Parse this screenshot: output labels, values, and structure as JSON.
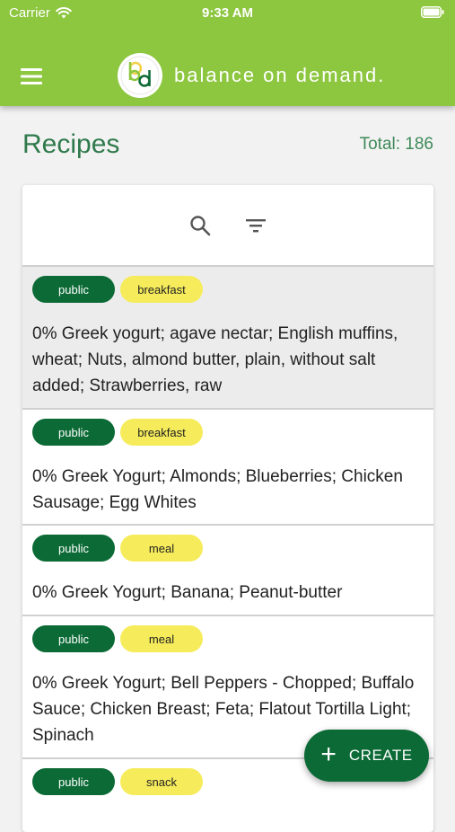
{
  "status_bar": {
    "carrier": "Carrier",
    "time": "9:33 AM"
  },
  "header": {
    "brand_name": "balance on demand.",
    "accent_color": "#8dc63f"
  },
  "page": {
    "title": "Recipes",
    "total": "Total: 186"
  },
  "toolbar": {
    "search_icon": "search-icon",
    "filter_icon": "filter-icon"
  },
  "recipes": [
    {
      "visibility": "public",
      "category": "breakfast",
      "ingredients": "0% Greek yogurt; agave nectar; English muffins, wheat; Nuts, almond butter, plain, without salt added; Strawberries, raw"
    },
    {
      "visibility": "public",
      "category": "breakfast",
      "ingredients": "0% Greek Yogurt; Almonds; Blueberries; Chicken Sausage; Egg Whites"
    },
    {
      "visibility": "public",
      "category": "meal",
      "ingredients": "0% Greek Yogurt; Banana; Peanut-butter"
    },
    {
      "visibility": "public",
      "category": "meal",
      "ingredients": "0% Greek Yogurt; Bell Peppers - Chopped; Buffalo Sauce; Chicken Breast; Feta; Flatout Tortilla Light; Spinach"
    },
    {
      "visibility": "public",
      "category": "snack",
      "ingredients": ""
    }
  ],
  "fab": {
    "icon": "plus-icon",
    "label": "CREATE",
    "color": "#0b6a35"
  }
}
